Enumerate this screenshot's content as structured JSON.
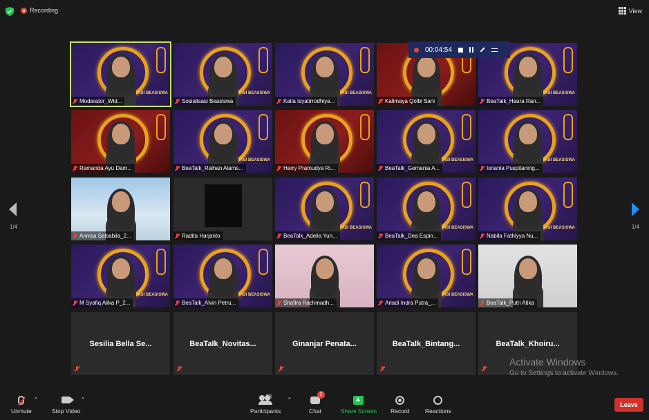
{
  "topbar": {
    "recording_label": "Recording",
    "view_label": "View"
  },
  "recording_bar": {
    "time": "00:04:54"
  },
  "navigation": {
    "page_left": "1/4",
    "page_right": "1/4"
  },
  "tiles": [
    {
      "name": "Moderator_Wid...",
      "bg": "purple",
      "video": true,
      "active": true
    },
    {
      "name": "Sosialisasi Beasiswa",
      "bg": "purple",
      "video": true
    },
    {
      "name": "Kaila Isyatirrodhiya...",
      "bg": "purple",
      "video": true
    },
    {
      "name": "Kalimaya Qolbi Sani",
      "bg": "red",
      "video": true
    },
    {
      "name": "BeaTalk_Haura Ran...",
      "bg": "purple",
      "video": true
    },
    {
      "name": "Ramanda Ayu Dam...",
      "bg": "red",
      "video": true
    },
    {
      "name": "BeaTalk_Raihan Alams...",
      "bg": "purple",
      "video": true
    },
    {
      "name": "Harry Pramudya Ri...",
      "bg": "red",
      "video": true
    },
    {
      "name": "BeaTalk_Gemania A...",
      "bg": "purple",
      "video": true
    },
    {
      "name": "Isnania Puspitaning...",
      "bg": "purple",
      "video": true
    },
    {
      "name": "Annisa Salsabila_2...",
      "bg": "sky",
      "video": true
    },
    {
      "name": "Radita Harjanto",
      "bg": "dark",
      "video": false,
      "camoff": true
    },
    {
      "name": "BeaTalk_Adelia Yun...",
      "bg": "purple",
      "video": true
    },
    {
      "name": "BeaTalk_Dea Espin...",
      "bg": "purple",
      "video": true
    },
    {
      "name": "Nabila Fathiyya Nu...",
      "bg": "purple",
      "video": true
    },
    {
      "name": "M Syafiq Alika P_2...",
      "bg": "purple",
      "video": true
    },
    {
      "name": "BeaTalk_Alvin Petru...",
      "bg": "purple",
      "video": true
    },
    {
      "name": "Shafira Rachmadh...",
      "bg": "pink",
      "video": true
    },
    {
      "name": "Ariadi Indra Putra_...",
      "bg": "purple",
      "video": true
    },
    {
      "name": "BeaTalk_Putri Atika",
      "bg": "wall",
      "video": true
    },
    {
      "name": "Sesilia Bella Se...",
      "bg": "dark",
      "video": false
    },
    {
      "name": "BeaTalk_Novitas...",
      "bg": "dark",
      "video": false
    },
    {
      "name": "Ginanjar Penata...",
      "bg": "dark",
      "video": false
    },
    {
      "name": "BeaTalk_Bintang...",
      "bg": "dark",
      "video": false
    },
    {
      "name": "BeaTalk_Khoiru...",
      "bg": "dark",
      "video": false
    }
  ],
  "tile_badge": "SOSIALISASI BEASISWA",
  "watermark": {
    "title": "Activate Windows",
    "subtitle": "Go to Settings to activate Windows."
  },
  "toolbar": {
    "unmute": "Unmute",
    "stop_video": "Stop Video",
    "participants": "Participants",
    "participants_count": "78",
    "chat": "Chat",
    "chat_badge": "2",
    "share_screen": "Share Screen",
    "record": "Record",
    "reactions": "Reactions",
    "leave": "Leave"
  },
  "colors": {
    "accent_green": "#23c552",
    "leave_red": "#d0312d",
    "active_border": "#c8e26a",
    "ring_orange": "#e8a21c"
  }
}
